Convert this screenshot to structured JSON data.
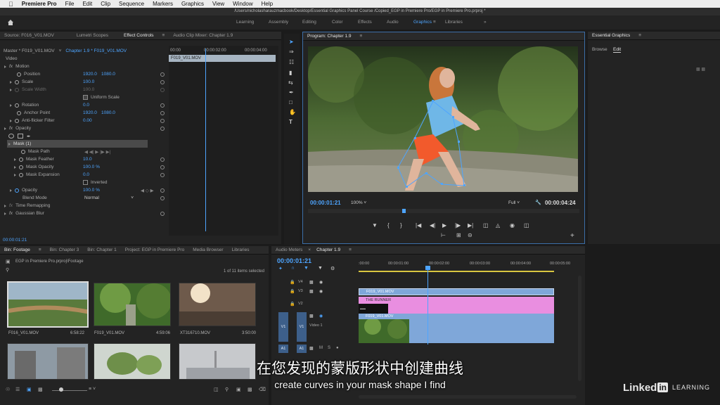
{
  "menubar": {
    "app_name": "Premiere Pro",
    "items": [
      "File",
      "Edit",
      "Clip",
      "Sequence",
      "Markers",
      "Graphics",
      "View",
      "Window",
      "Help"
    ]
  },
  "titlebar": {
    "path": "/Users/nicholasharauzmacbook/Desktop/Essential Graphics Panel Course /Copied_EGP in Premiere Pro/EGP in Premiere Pro.prproj *"
  },
  "workspaces": {
    "items": [
      "Learning",
      "Assembly",
      "Editing",
      "Color",
      "Effects",
      "Audio",
      "Graphics",
      "Libraries"
    ],
    "active": "Graphics",
    "more": "»"
  },
  "source_tabs": [
    "Source: F016_V01.MOV",
    "Lumetri Scopes",
    "Effect Controls",
    "Audio Clip Mixer: Chapter 1.9"
  ],
  "effect_controls": {
    "master": "Master * F019_V01.MOV",
    "sequence_clip": "Chapter 1.9 * F019_V01.MOV",
    "ruler": [
      "00:00",
      "00:00:02:00",
      "00:00:04:00"
    ],
    "clip_name": "F019_V01.MOV",
    "section_video": "Video",
    "motion": "Motion",
    "position_label": "Position",
    "position_x": "1920.0",
    "position_y": "1080.0",
    "scale_label": "Scale",
    "scale_value": "100.0",
    "scale_width_label": "Scale Width",
    "scale_width_value": "100.0",
    "uniform_scale": "Uniform Scale",
    "rotation_label": "Rotation",
    "rotation_value": "0.0",
    "anchor_label": "Anchor Point",
    "anchor_x": "1920.0",
    "anchor_y": "1080.0",
    "antiflicker_label": "Anti-flicker Filter",
    "antiflicker_value": "0.00",
    "opacity_section": "Opacity",
    "mask_name": "Mask (1)",
    "mask_path": "Mask Path",
    "mask_feather_label": "Mask Feather",
    "mask_feather_value": "10.0",
    "mask_opacity_label": "Mask Opacity",
    "mask_opacity_value": "100.0 %",
    "mask_expansion_label": "Mask Expansion",
    "mask_expansion_value": "0.0",
    "inverted": "Inverted",
    "opacity_label": "Opacity",
    "opacity_value": "100.0 %",
    "blend_label": "Blend Mode",
    "blend_value": "Normal",
    "time_remapping": "Time Remapping",
    "gaussian_blur": "Gaussian Blur",
    "timecode": "00:00:01:21"
  },
  "program": {
    "tab": "Program: Chapter 1.9",
    "timecode": "00:00:01:21",
    "zoom": "100%",
    "quality": "Full",
    "duration": "00:00:04:24"
  },
  "essential_graphics": {
    "title": "Essential Graphics",
    "tabs": [
      "Browse",
      "Edit"
    ],
    "active_tab": "Edit"
  },
  "bin": {
    "tabs": [
      "Bin: Footage",
      "Bin: Chapter 3",
      "Bin: Chapter 1",
      "Project: EGP in Premiere Pro",
      "Media Browser",
      "Libraries"
    ],
    "path": "EGP in Premiere Pro.prproj\\Footage",
    "count": "1 of 11 items selected",
    "items": [
      {
        "name": "F016_V01.MOV",
        "duration": "6:58:22"
      },
      {
        "name": "F019_V01.MOV",
        "duration": "4:59:06"
      },
      {
        "name": "XT316710.MOV",
        "duration": "3:50:00"
      }
    ]
  },
  "timeline": {
    "tabs": [
      "Audio Meters",
      "Chapter 1.9"
    ],
    "timecode": "00:00:01:21",
    "ruler": [
      ":00:00",
      "00:00:01:00",
      "00:00:02:00",
      "00:00:03:00",
      "00:00:04:00",
      "00:00:05:00"
    ],
    "tracks": [
      "V4",
      "V3",
      "V2",
      "V1",
      "A1"
    ],
    "video1_label": "Video 1",
    "clips": [
      {
        "name": "F019_V01.MOV",
        "color": "#7fa7d9"
      },
      {
        "name": "THE RUNNER",
        "color": "#e98ee0"
      },
      {
        "name": "F019_V01.MOV",
        "color": "#7fa7d9"
      }
    ]
  },
  "subtitles": {
    "chinese": "在您发现的蒙版形状中创建曲线",
    "english": "create curves in your mask shape I find"
  },
  "watermark": {
    "brand": "Linked",
    "in": "in",
    "learning": "LEARNING"
  }
}
